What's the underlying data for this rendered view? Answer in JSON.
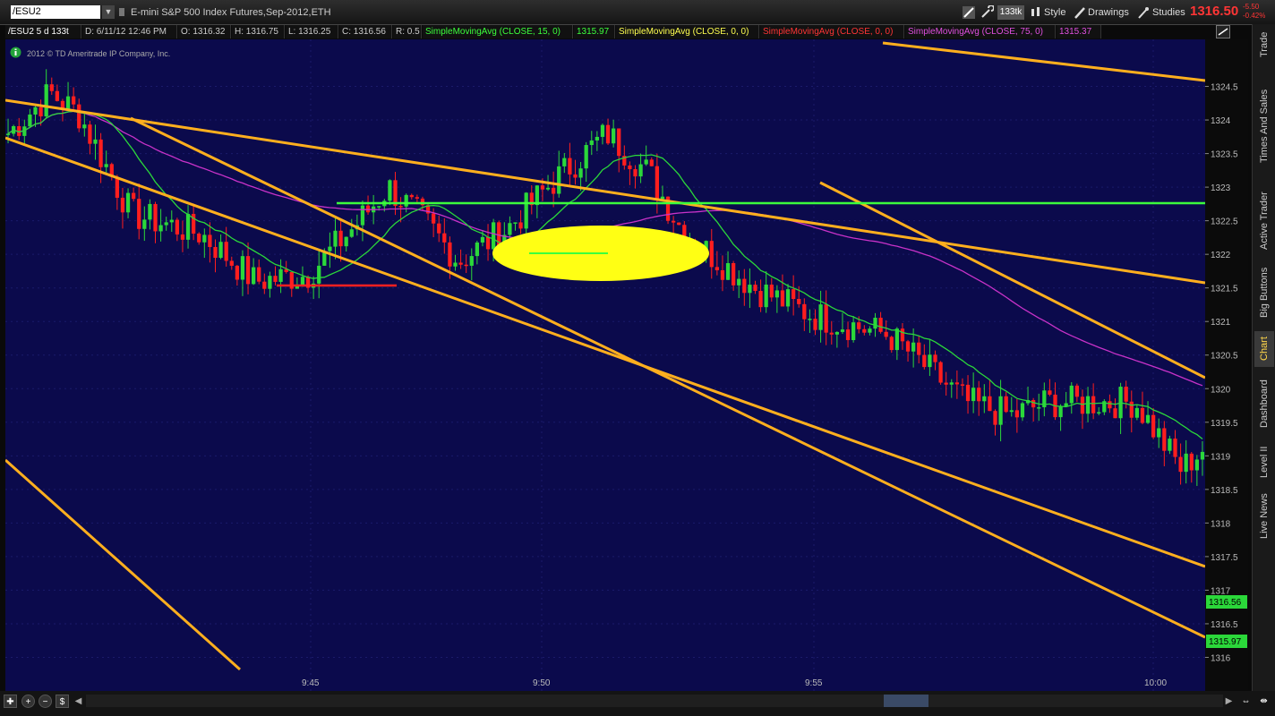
{
  "topbar": {
    "symbol": "/ESU2",
    "title": "E-mini S&P 500 Index Futures,Sep-2012,ETH",
    "aggregation": "133tk",
    "style_label": "Style",
    "drawings_label": "Drawings",
    "studies_label": "Studies",
    "last_price": "1316.50",
    "change": "-5.50",
    "change_pct": "-0.42%"
  },
  "infobar": {
    "symbol_period": "/ESU2 5 d 133t",
    "date": "D: 6/11/12 12:46 PM",
    "open": "O: 1316.32",
    "high": "H: 1316.75",
    "low": "L: 1316.25",
    "close": "C: 1316.56",
    "range": "R: 0.5",
    "sma15_label": "SimpleMovingAvg (CLOSE, 15, 0)",
    "sma15_value": "1315.97",
    "sma_a_label": "SimpleMovingAvg (CLOSE, 0, 0)",
    "sma_b_label": "SimpleMovingAvg (CLOSE, 0, 0)",
    "sma75_label": "SimpleMovingAvg (CLOSE, 75, 0)",
    "sma75_value": "1315.37"
  },
  "copyright": "2012 © TD Ameritrade IP Company, Inc.",
  "colors": {
    "background": "#0b0a4c",
    "up": "#2bd83a",
    "down": "#ff1e1e",
    "sma15": "#2bd83a",
    "sma75": "#c832c8",
    "trendline": "#ffaf1e",
    "support": "#3cff3c",
    "highlight": "#ffff14"
  },
  "price_axis": {
    "ticks": [
      "1324.5",
      "1324",
      "1323.5",
      "1323",
      "1322.5",
      "1322",
      "1321.5",
      "1321",
      "1320.5",
      "1320",
      "1319.5",
      "1319",
      "1318.5",
      "1318",
      "1317.5",
      "1317",
      "1316.5",
      "1316"
    ],
    "marker_close": "1316.56",
    "marker_sma": "1315.97"
  },
  "time_axis": {
    "ticks": [
      "9:45",
      "9:50",
      "9:55",
      "10:00"
    ]
  },
  "sidebar": {
    "tabs": [
      "Trade",
      "Times And Sales",
      "Active Trader",
      "Big Buttons",
      "Chart",
      "Dashboard",
      "Level II",
      "Live News"
    ]
  },
  "chart_data": {
    "type": "candlestick",
    "y_min": 1315.5,
    "y_max": 1325.2,
    "bar_count": 220,
    "key_points": [
      [
        0,
        1323.8
      ],
      [
        12,
        1324.4
      ],
      [
        20,
        1324.1
      ],
      [
        35,
        1322.6
      ],
      [
        55,
        1322.3
      ],
      [
        70,
        1321.6
      ],
      [
        85,
        1321.7
      ],
      [
        98,
        1322.4
      ],
      [
        108,
        1323.0
      ],
      [
        118,
        1322.5
      ],
      [
        128,
        1321.9
      ],
      [
        142,
        1322.4
      ],
      [
        155,
        1323.1
      ],
      [
        170,
        1323.8
      ],
      [
        182,
        1323.2
      ],
      [
        192,
        1322.3
      ],
      [
        212,
        1321.5
      ],
      [
        228,
        1321.1
      ],
      [
        250,
        1320.8
      ],
      [
        272,
        1319.8
      ],
      [
        285,
        1319.6
      ],
      [
        295,
        1319.8
      ],
      [
        320,
        1319.8
      ],
      [
        333,
        1318.8
      ],
      [
        339,
        1319.1
      ]
    ]
  }
}
